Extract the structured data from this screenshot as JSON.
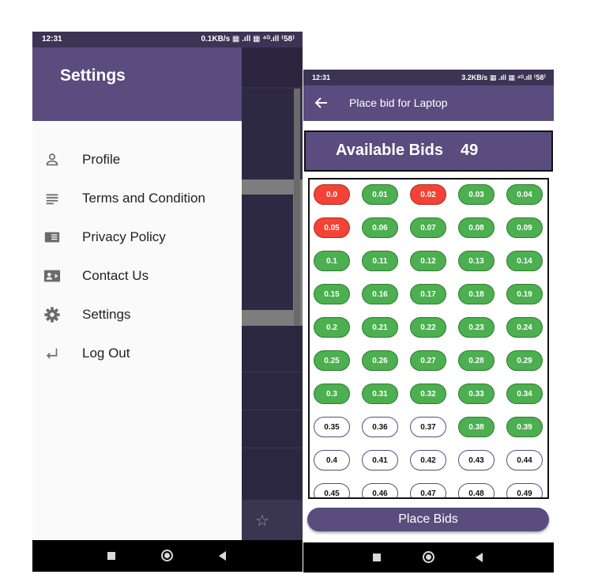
{
  "left_phone": {
    "status_bar": {
      "time": "12:31",
      "right": "0.1KB/s ▦ .ıll ▦ ⁴ᴳ.ıll ⁽58⁾"
    },
    "drawer": {
      "title": "Settings",
      "items": [
        {
          "label": "Profile",
          "icon": "person-icon"
        },
        {
          "label": "Terms and Condition",
          "icon": "notes-icon"
        },
        {
          "label": "Privacy Policy",
          "icon": "document-icon"
        },
        {
          "label": "Contact Us",
          "icon": "contact-card-icon"
        },
        {
          "label": "Settings",
          "icon": "gear-icon"
        },
        {
          "label": "Log Out",
          "icon": "return-arrow-icon"
        }
      ]
    },
    "background_star": "☆"
  },
  "right_phone": {
    "status_bar": {
      "time": "12:31",
      "right": "3.2KB/s ▦ .ıll ▦ ⁴ᴳ.ıll ⁽58⁾"
    },
    "appbar": {
      "title": "Place bid for Laptop"
    },
    "available": {
      "label": "Available Bids",
      "count": "49"
    },
    "bids": [
      [
        {
          "v": "0.0",
          "s": "red"
        },
        {
          "v": "0.01",
          "s": "green"
        },
        {
          "v": "0.02",
          "s": "red"
        },
        {
          "v": "0.03",
          "s": "green"
        },
        {
          "v": "0.04",
          "s": "green"
        }
      ],
      [
        {
          "v": "0.05",
          "s": "red"
        },
        {
          "v": "0.06",
          "s": "green"
        },
        {
          "v": "0.07",
          "s": "green"
        },
        {
          "v": "0.08",
          "s": "green"
        },
        {
          "v": "0.09",
          "s": "green"
        }
      ],
      [
        {
          "v": "0.1",
          "s": "green"
        },
        {
          "v": "0.11",
          "s": "green"
        },
        {
          "v": "0.12",
          "s": "green"
        },
        {
          "v": "0.13",
          "s": "green"
        },
        {
          "v": "0.14",
          "s": "green"
        }
      ],
      [
        {
          "v": "0.15",
          "s": "green"
        },
        {
          "v": "0.16",
          "s": "green"
        },
        {
          "v": "0.17",
          "s": "green"
        },
        {
          "v": "0.18",
          "s": "green"
        },
        {
          "v": "0.19",
          "s": "green"
        }
      ],
      [
        {
          "v": "0.2",
          "s": "green"
        },
        {
          "v": "0.21",
          "s": "green"
        },
        {
          "v": "0.22",
          "s": "green"
        },
        {
          "v": "0.23",
          "s": "green"
        },
        {
          "v": "0.24",
          "s": "green"
        }
      ],
      [
        {
          "v": "0.25",
          "s": "green"
        },
        {
          "v": "0.26",
          "s": "green"
        },
        {
          "v": "0.27",
          "s": "green"
        },
        {
          "v": "0.28",
          "s": "green"
        },
        {
          "v": "0.29",
          "s": "green"
        }
      ],
      [
        {
          "v": "0.3",
          "s": "green"
        },
        {
          "v": "0.31",
          "s": "green"
        },
        {
          "v": "0.32",
          "s": "green"
        },
        {
          "v": "0.33",
          "s": "green"
        },
        {
          "v": "0.34",
          "s": "green"
        }
      ],
      [
        {
          "v": "0.35",
          "s": "white"
        },
        {
          "v": "0.36",
          "s": "white"
        },
        {
          "v": "0.37",
          "s": "white"
        },
        {
          "v": "0.38",
          "s": "green"
        },
        {
          "v": "0.39",
          "s": "green"
        }
      ],
      [
        {
          "v": "0.4",
          "s": "white"
        },
        {
          "v": "0.41",
          "s": "white"
        },
        {
          "v": "0.42",
          "s": "white"
        },
        {
          "v": "0.43",
          "s": "white"
        },
        {
          "v": "0.44",
          "s": "white"
        }
      ],
      [
        {
          "v": "0.45",
          "s": "white"
        },
        {
          "v": "0.46",
          "s": "white"
        },
        {
          "v": "0.47",
          "s": "white"
        },
        {
          "v": "0.48",
          "s": "white"
        },
        {
          "v": "0.49",
          "s": "white"
        }
      ]
    ],
    "place_button": "Place Bids"
  },
  "colors": {
    "primary": "#5a4c7e",
    "bid_taken_red": "#f44336",
    "bid_green": "#4caf50",
    "bid_available": "#ffffff"
  }
}
